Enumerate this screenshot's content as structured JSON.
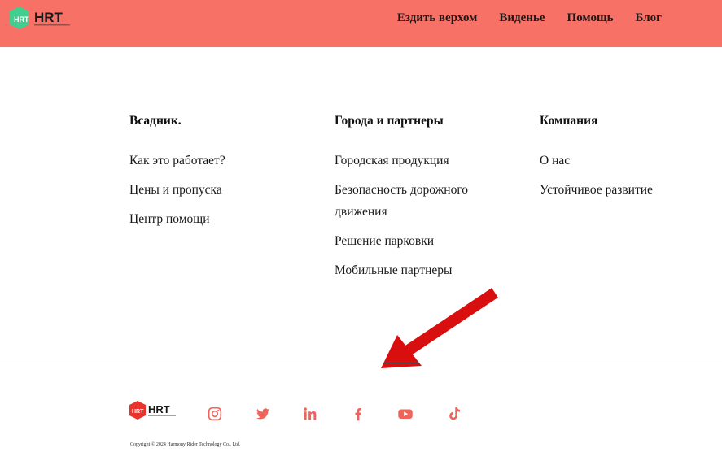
{
  "header": {
    "logo_text": "HRT",
    "nav": [
      {
        "label": "Ездить верхом"
      },
      {
        "label": "Виденье"
      },
      {
        "label": "Помощь"
      },
      {
        "label": "Блог"
      }
    ]
  },
  "columns": [
    {
      "title": "Всадник.",
      "items": [
        "Как это работает?",
        "Цены и пропуска",
        "Центр помощи"
      ]
    },
    {
      "title": "Города и партнеры",
      "items": [
        "Городская продукция",
        "Безопасность дорожного движения",
        "Решение парковки",
        "Мобильные партнеры"
      ]
    },
    {
      "title": "Компания",
      "items": [
        "О нас",
        "Устойчивое развитие"
      ]
    }
  ],
  "footer": {
    "logo_text": "HRT",
    "social_icons": [
      "instagram-icon",
      "twitter-icon",
      "linkedin-icon",
      "facebook-icon",
      "youtube-icon",
      "tiktok-icon"
    ],
    "copyright": "Copyright © 2024 Harmony Rider Technology Co., Ltd."
  },
  "colors": {
    "header_bg": "#f87166",
    "social_icon": "#f0635a",
    "annotation_arrow": "#d90f0f",
    "logo_green": "#3fcf8e"
  }
}
